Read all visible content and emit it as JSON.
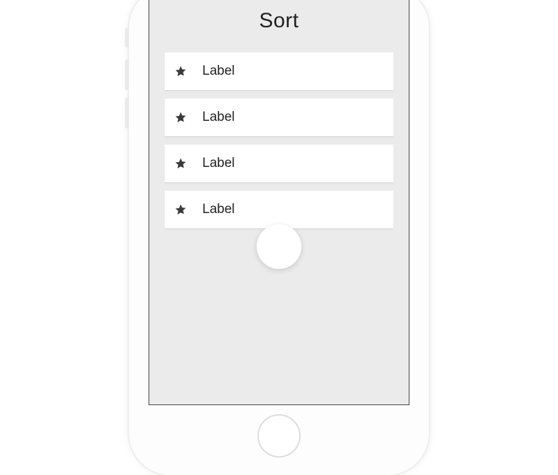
{
  "title": "Sort",
  "items": [
    {
      "icon": "star",
      "label": "Label"
    },
    {
      "icon": "star",
      "label": "Label"
    },
    {
      "icon": "star",
      "label": "Label"
    },
    {
      "icon": "star",
      "label": "Label"
    }
  ]
}
